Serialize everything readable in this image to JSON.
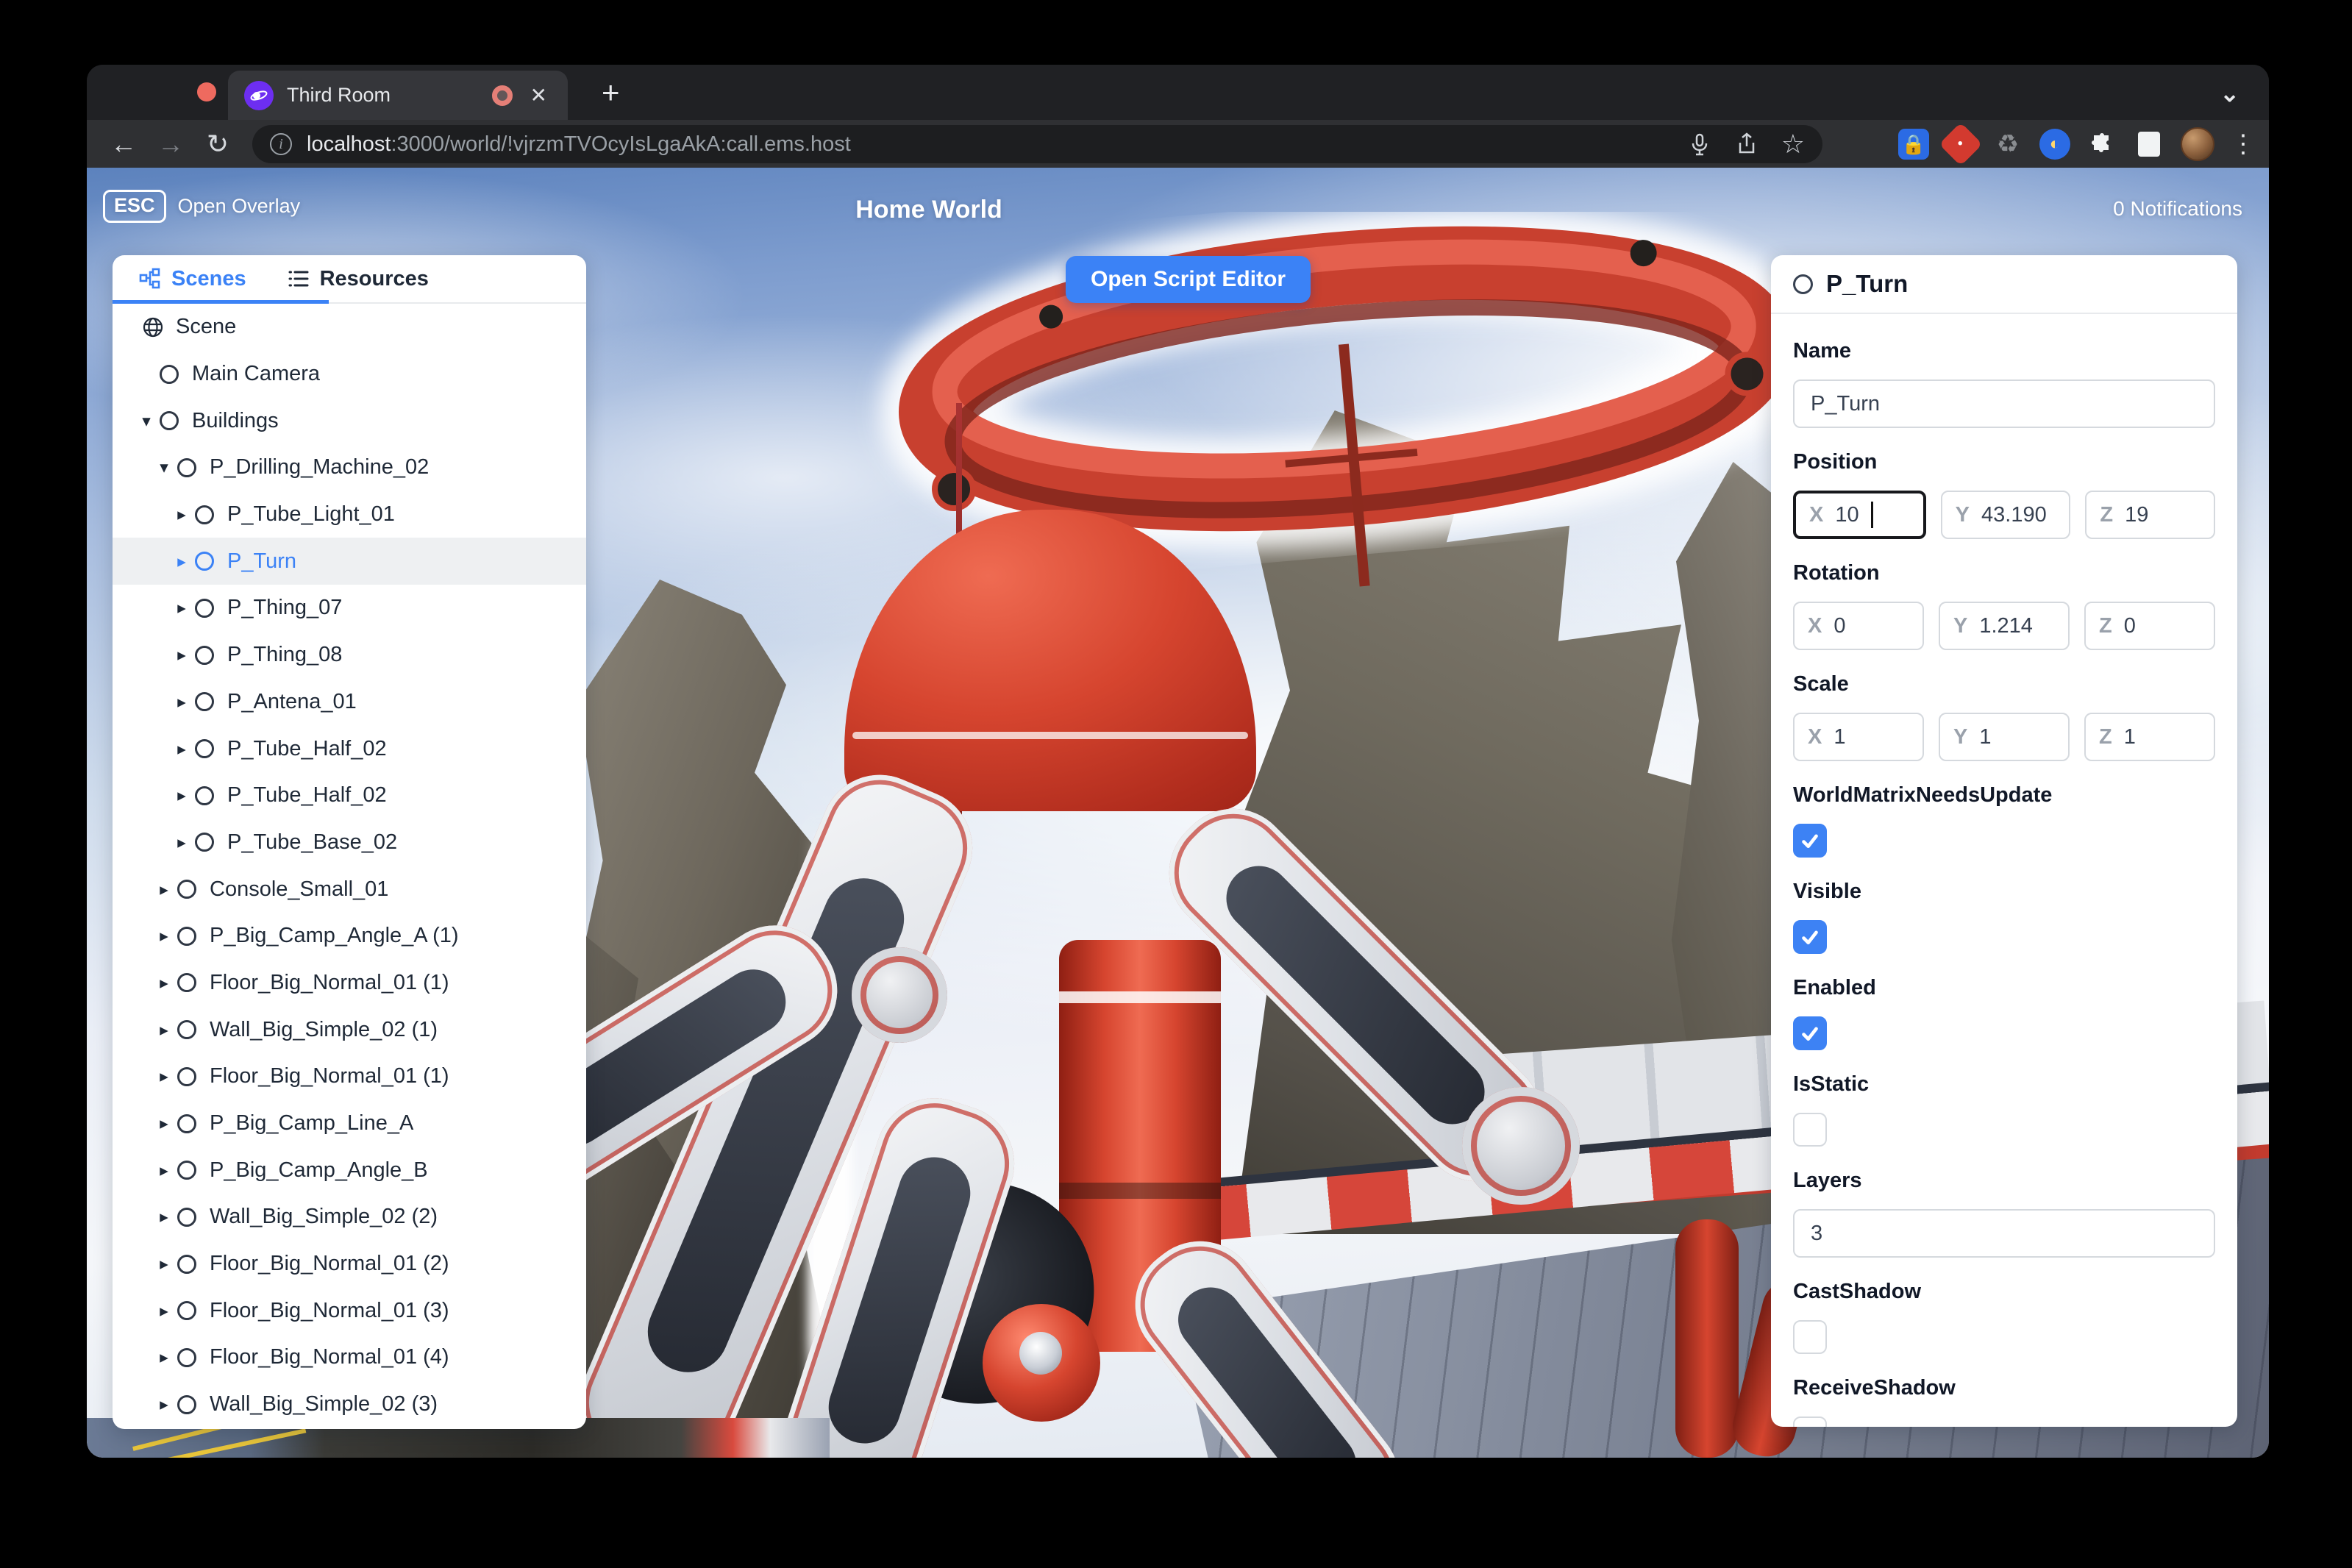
{
  "colors": {
    "accent": "#3b82f6",
    "checkbox_checked": "#3d82f4",
    "ring_red": "#c8402f",
    "dome_red": "#d6452f",
    "selected_row_bg": "#eef0f2"
  },
  "icons": {
    "close": "✕",
    "plus": "+",
    "chevron_down": "⌄",
    "back": "←",
    "forward": "→",
    "reload": "↻",
    "star": "☆",
    "recycle": "♻",
    "menu_dots": "⋮",
    "red_ext_dot": "•",
    "doc_ext": "◐",
    "puzzle": "🧩",
    "info": "i",
    "expander_down": "▾",
    "expander_right": "▸"
  },
  "browser": {
    "tab_title": "Third Room",
    "url_host": "localhost",
    "url_rest": ":3000/world/!vjrzmTVOcyIsLgaAkA:call.ems.host"
  },
  "hud": {
    "esc_key": "ESC",
    "open_overlay": "Open Overlay",
    "world_title": "Home World",
    "notifications": "0 Notifications",
    "open_script_editor": "Open Script Editor"
  },
  "scene_panel": {
    "tabs": [
      {
        "label": "Scenes",
        "active": true
      },
      {
        "label": "Resources",
        "active": false
      }
    ],
    "tree": [
      {
        "label": "Scene",
        "depth": 0,
        "icon": "globe",
        "expander": "none"
      },
      {
        "label": "Main Camera",
        "depth": 1,
        "icon": "circle",
        "expander": "none"
      },
      {
        "label": "Buildings",
        "depth": 1,
        "icon": "circle",
        "expander": "down"
      },
      {
        "label": "P_Drilling_Machine_02",
        "depth": 2,
        "icon": "circle",
        "expander": "down"
      },
      {
        "label": "P_Tube_Light_01",
        "depth": 3,
        "icon": "circle",
        "expander": "right"
      },
      {
        "label": "P_Turn",
        "depth": 3,
        "icon": "circle",
        "expander": "right",
        "selected": true
      },
      {
        "label": "P_Thing_07",
        "depth": 3,
        "icon": "circle",
        "expander": "right"
      },
      {
        "label": "P_Thing_08",
        "depth": 3,
        "icon": "circle",
        "expander": "right"
      },
      {
        "label": "P_Antena_01",
        "depth": 3,
        "icon": "circle",
        "expander": "right"
      },
      {
        "label": "P_Tube_Half_02",
        "depth": 3,
        "icon": "circle",
        "expander": "right"
      },
      {
        "label": "P_Tube_Half_02",
        "depth": 3,
        "icon": "circle",
        "expander": "right"
      },
      {
        "label": "P_Tube_Base_02",
        "depth": 3,
        "icon": "circle",
        "expander": "right"
      },
      {
        "label": "Console_Small_01",
        "depth": 2,
        "icon": "circle",
        "expander": "right"
      },
      {
        "label": "P_Big_Camp_Angle_A (1)",
        "depth": 2,
        "icon": "circle",
        "expander": "right"
      },
      {
        "label": "Floor_Big_Normal_01 (1)",
        "depth": 2,
        "icon": "circle",
        "expander": "right"
      },
      {
        "label": "Wall_Big_Simple_02 (1)",
        "depth": 2,
        "icon": "circle",
        "expander": "right"
      },
      {
        "label": "Floor_Big_Normal_01 (1)",
        "depth": 2,
        "icon": "circle",
        "expander": "right"
      },
      {
        "label": "P_Big_Camp_Line_A",
        "depth": 2,
        "icon": "circle",
        "expander": "right"
      },
      {
        "label": "P_Big_Camp_Angle_B",
        "depth": 2,
        "icon": "circle",
        "expander": "right"
      },
      {
        "label": "Wall_Big_Simple_02 (2)",
        "depth": 2,
        "icon": "circle",
        "expander": "right"
      },
      {
        "label": "Floor_Big_Normal_01 (2)",
        "depth": 2,
        "icon": "circle",
        "expander": "right"
      },
      {
        "label": "Floor_Big_Normal_01 (3)",
        "depth": 2,
        "icon": "circle",
        "expander": "right"
      },
      {
        "label": "Floor_Big_Normal_01 (4)",
        "depth": 2,
        "icon": "circle",
        "expander": "right"
      },
      {
        "label": "Wall_Big_Simple_02 (3)",
        "depth": 2,
        "icon": "circle",
        "expander": "right"
      }
    ]
  },
  "inspector": {
    "header_title": "P_Turn",
    "name": {
      "label": "Name",
      "value": "P_Turn"
    },
    "position": {
      "label": "Position",
      "fields": [
        {
          "axis": "X",
          "value": "10",
          "focused": true
        },
        {
          "axis": "Y",
          "value": "43.190"
        },
        {
          "axis": "Z",
          "value": "19"
        }
      ]
    },
    "rotation": {
      "label": "Rotation",
      "fields": [
        {
          "axis": "X",
          "value": "0"
        },
        {
          "axis": "Y",
          "value": "1.214"
        },
        {
          "axis": "Z",
          "value": "0"
        }
      ]
    },
    "scale": {
      "label": "Scale",
      "fields": [
        {
          "axis": "X",
          "value": "1"
        },
        {
          "axis": "Y",
          "value": "1"
        },
        {
          "axis": "Z",
          "value": "1"
        }
      ]
    },
    "flags": [
      {
        "label": "WorldMatrixNeedsUpdate",
        "checked": true
      },
      {
        "label": "Visible",
        "checked": true
      },
      {
        "label": "Enabled",
        "checked": true
      },
      {
        "label": "IsStatic",
        "checked": false
      }
    ],
    "layers": {
      "label": "Layers",
      "value": "3"
    },
    "shadow_flags": [
      {
        "label": "CastShadow",
        "checked": false
      },
      {
        "label": "ReceiveShadow",
        "checked": false
      }
    ]
  }
}
